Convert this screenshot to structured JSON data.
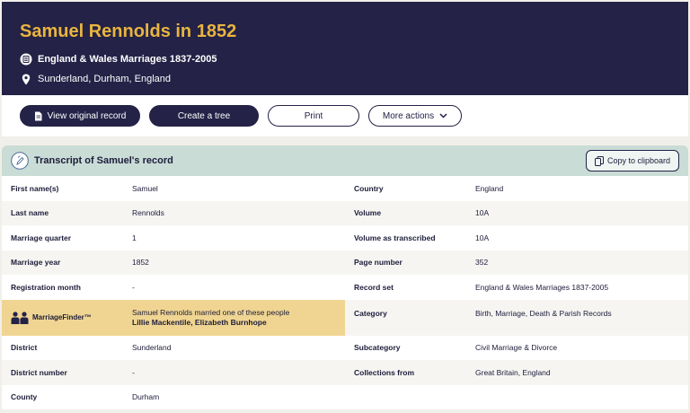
{
  "header": {
    "title": "Samuel Rennolds in 1852",
    "collection": "England & Wales Marriages 1837-2005",
    "place": "Sunderland, Durham, England"
  },
  "actions": {
    "view_original": "View original record",
    "create_tree": "Create a tree",
    "print": "Print",
    "more_actions": "More actions"
  },
  "transcript": {
    "title": "Transcript of Samuel's record",
    "copy_label": "Copy to clipboard"
  },
  "left_rows": [
    {
      "label": "First name(s)",
      "value": "Samuel"
    },
    {
      "label": "Last name",
      "value": "Rennolds"
    },
    {
      "label": "Marriage quarter",
      "value": "1"
    },
    {
      "label": "Marriage year",
      "value": "1852"
    },
    {
      "label": "Registration month",
      "value": "-"
    },
    {
      "label": "District",
      "value": "Sunderland"
    },
    {
      "label": "District number",
      "value": "-"
    },
    {
      "label": "County",
      "value": "Durham"
    }
  ],
  "marriage_finder": {
    "label": "MarriageFinder™",
    "text": "Samuel Rennolds married one of these people",
    "names": "Lillie Mackentile, Elizabeth Burnhope"
  },
  "right_rows": [
    {
      "label": "Country",
      "value": "England"
    },
    {
      "label": "Volume",
      "value": "10A"
    },
    {
      "label": "Volume as transcribed",
      "value": "10A"
    },
    {
      "label": "Page number",
      "value": "352"
    },
    {
      "label": "Record set",
      "value": "England & Wales Marriages 1837-2005"
    },
    {
      "label": "Category",
      "value": "Birth, Marriage, Death & Parish Records"
    },
    {
      "label": "Subcategory",
      "value": "Civil Marriage & Divorce"
    },
    {
      "label": "Collections from",
      "value": "Great Britain, England"
    }
  ]
}
